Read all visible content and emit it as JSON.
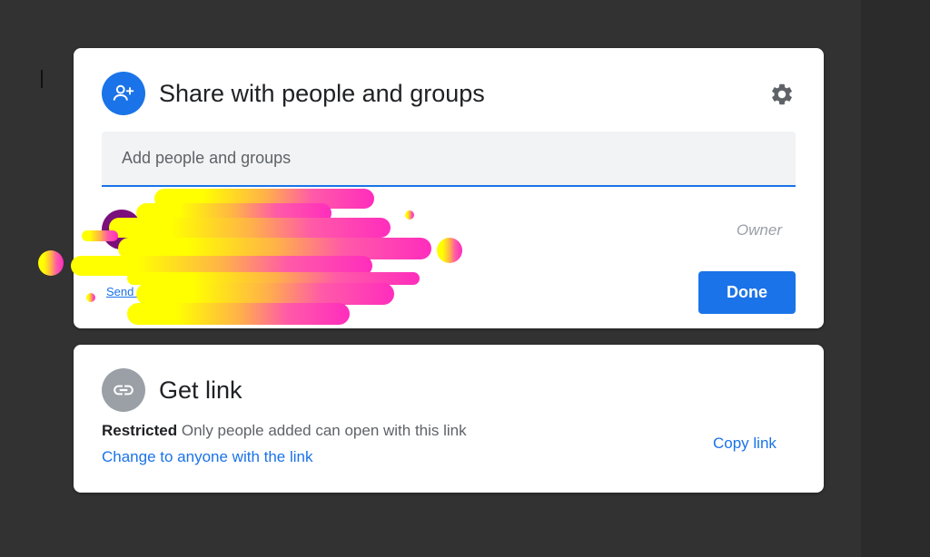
{
  "share_dialog": {
    "title": "Share with people and groups",
    "icon": "person-add-icon",
    "settings_icon": "gear-icon",
    "add_input": {
      "placeholder": "Add people and groups",
      "value": ""
    },
    "person": {
      "role": "Owner"
    },
    "feedback_link": "Send feedback",
    "done_label": "Done"
  },
  "get_link": {
    "title": "Get link",
    "icon": "link-icon",
    "access_level": "Restricted",
    "access_description": "Only people added can open with this link",
    "change_label": "Change to anyone with the link",
    "copy_label": "Copy link"
  },
  "colors": {
    "background": "#323232",
    "accent": "#1a73e8",
    "avatar": "#7b0f7b",
    "redaction_start": "#ffff00",
    "redaction_end": "#ff2dbd"
  }
}
